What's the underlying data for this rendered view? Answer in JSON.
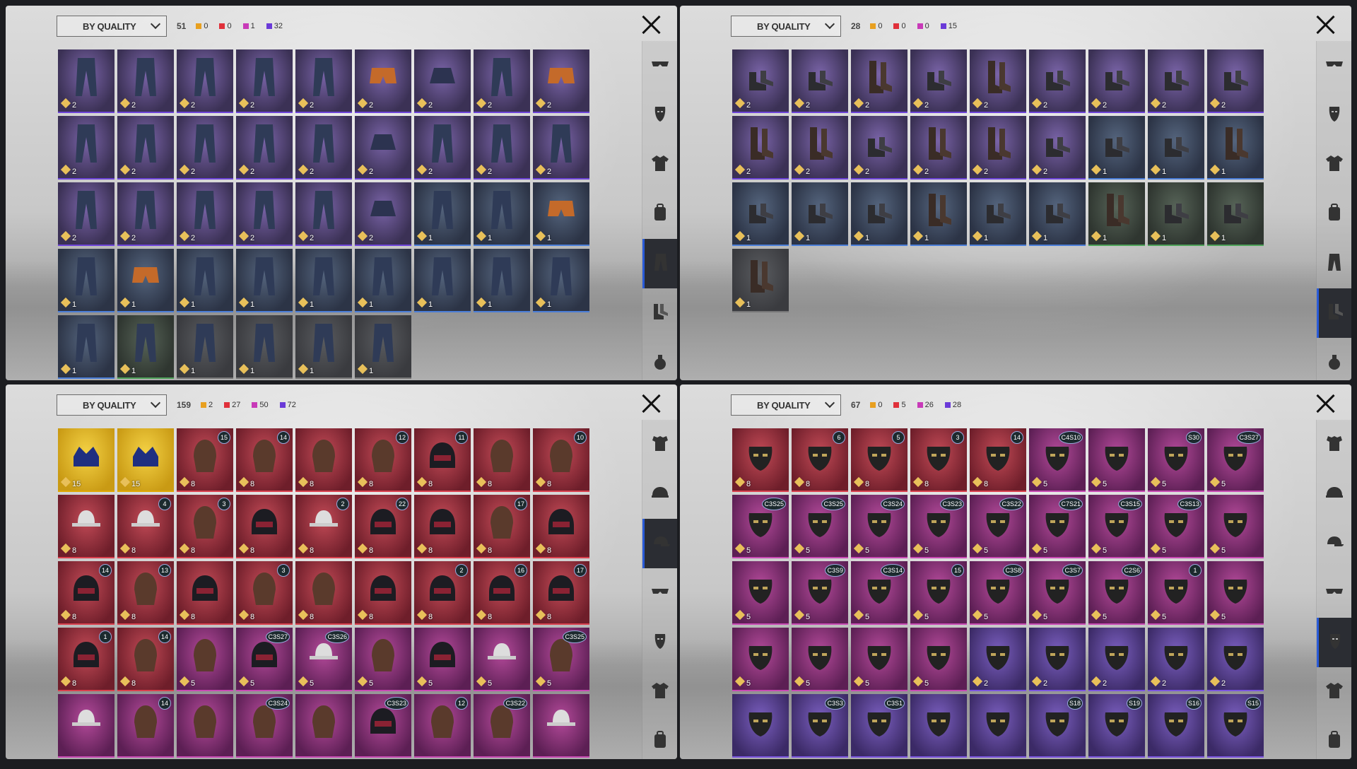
{
  "colors": {
    "legendary": "#e8a020",
    "mythic": "#e0303a",
    "epic": "#c83ab8",
    "rare": "#6a3ad8"
  },
  "panels": [
    {
      "sort_label": "BY QUALITY",
      "total": "51",
      "q": [
        "0",
        "0",
        "1",
        "32"
      ],
      "nav": [
        "goggles-icon",
        "mask-icon",
        "jacket-icon",
        "backpack-icon",
        "pants-icon",
        "shoes-icon",
        "grenade-icon"
      ],
      "active": 4,
      "tiles": [
        [
          "purple",
          "2",
          "pants"
        ],
        [
          "purple",
          "2",
          "pants"
        ],
        [
          "purple",
          "2",
          "pants"
        ],
        [
          "purple",
          "2",
          "pants"
        ],
        [
          "purple",
          "2",
          "pants"
        ],
        [
          "purple",
          "2",
          "shorts"
        ],
        [
          "purple",
          "2",
          "skirt"
        ],
        [
          "purple",
          "2",
          "pants"
        ],
        [
          "purple",
          "2",
          "shorts"
        ],
        [
          "purple",
          "2",
          "pants"
        ],
        [
          "purple",
          "2",
          "pants"
        ],
        [
          "purple",
          "2",
          "pants"
        ],
        [
          "purple",
          "2",
          "pants"
        ],
        [
          "purple",
          "2",
          "pants"
        ],
        [
          "purple",
          "2",
          "skirt"
        ],
        [
          "purple",
          "2",
          "pants"
        ],
        [
          "purple",
          "2",
          "pants"
        ],
        [
          "purple",
          "2",
          "pants"
        ],
        [
          "purple",
          "2",
          "pants"
        ],
        [
          "purple",
          "2",
          "pants"
        ],
        [
          "purple",
          "2",
          "pants"
        ],
        [
          "purple",
          "2",
          "pants"
        ],
        [
          "purple",
          "2",
          "pants"
        ],
        [
          "purple",
          "2",
          "skirt"
        ],
        [
          "blue",
          "1",
          "pants"
        ],
        [
          "blue",
          "1",
          "pants"
        ],
        [
          "blue",
          "1",
          "shorts"
        ],
        [
          "blue",
          "1",
          "pants"
        ],
        [
          "blue",
          "1",
          "shorts"
        ],
        [
          "blue",
          "1",
          "pants"
        ],
        [
          "blue",
          "1",
          "pants"
        ],
        [
          "blue",
          "1",
          "pants"
        ],
        [
          "blue",
          "1",
          "pants"
        ],
        [
          "blue",
          "1",
          "pants"
        ],
        [
          "blue",
          "1",
          "pants"
        ],
        [
          "blue",
          "1",
          "pants"
        ],
        [
          "blue",
          "1",
          "pants"
        ],
        [
          "green",
          "1",
          "pants"
        ],
        [
          "gray",
          "1",
          "pants"
        ],
        [
          "gray",
          "1",
          "pants"
        ],
        [
          "gray",
          "1",
          "pants"
        ],
        [
          "gray",
          "1",
          "pants"
        ]
      ]
    },
    {
      "sort_label": "BY QUALITY",
      "total": "28",
      "q": [
        "0",
        "0",
        "0",
        "15"
      ],
      "nav": [
        "goggles-icon",
        "mask-icon",
        "jacket-icon",
        "backpack-icon",
        "pants-icon",
        "shoes-icon",
        "grenade-icon"
      ],
      "active": 5,
      "tiles": [
        [
          "purple",
          "2",
          "shoe"
        ],
        [
          "purple",
          "2",
          "shoe"
        ],
        [
          "purple",
          "2",
          "boot"
        ],
        [
          "purple",
          "2",
          "shoe"
        ],
        [
          "purple",
          "2",
          "boot"
        ],
        [
          "purple",
          "2",
          "shoe"
        ],
        [
          "purple",
          "2",
          "shoe"
        ],
        [
          "purple",
          "2",
          "shoe"
        ],
        [
          "purple",
          "2",
          "shoe"
        ],
        [
          "purple",
          "2",
          "boot"
        ],
        [
          "purple",
          "2",
          "boot"
        ],
        [
          "purple",
          "2",
          "shoe"
        ],
        [
          "purple",
          "2",
          "boot"
        ],
        [
          "purple",
          "2",
          "boot"
        ],
        [
          "purple",
          "2",
          "shoe"
        ],
        [
          "blue",
          "1",
          "shoe"
        ],
        [
          "blue",
          "1",
          "shoe"
        ],
        [
          "blue",
          "1",
          "boot"
        ],
        [
          "blue",
          "1",
          "shoe"
        ],
        [
          "blue",
          "1",
          "shoe"
        ],
        [
          "blue",
          "1",
          "shoe"
        ],
        [
          "blue",
          "1",
          "boot"
        ],
        [
          "blue",
          "1",
          "shoe"
        ],
        [
          "blue",
          "1",
          "shoe"
        ],
        [
          "green",
          "1",
          "boot"
        ],
        [
          "green",
          "1",
          "shoe"
        ],
        [
          "green",
          "1",
          "shoe"
        ],
        [
          "gray",
          "1",
          "boot"
        ]
      ]
    },
    {
      "sort_label": "BY QUALITY",
      "total": "159",
      "q": [
        "2",
        "27",
        "50",
        "72"
      ],
      "nav": [
        "outfit-icon",
        "helmet-icon",
        "cap-icon",
        "goggles-icon",
        "mask-icon",
        "jacket-icon",
        "backpack-icon"
      ],
      "active": 2,
      "tiles": [
        [
          "gold",
          "15",
          "crown",
          ""
        ],
        [
          "gold",
          "15",
          "crown",
          ""
        ],
        [
          "red",
          "8",
          "hair",
          "15"
        ],
        [
          "red",
          "8",
          "hair",
          "14"
        ],
        [
          "red",
          "8",
          "hair",
          ""
        ],
        [
          "red",
          "8",
          "hair",
          "12"
        ],
        [
          "red",
          "8",
          "helmet",
          "11"
        ],
        [
          "red",
          "8",
          "hair",
          ""
        ],
        [
          "red",
          "8",
          "hair",
          "10"
        ],
        [
          "red",
          "8",
          "hat",
          ""
        ],
        [
          "red",
          "8",
          "hat",
          "4"
        ],
        [
          "red",
          "8",
          "hair",
          "3"
        ],
        [
          "red",
          "8",
          "helmet",
          ""
        ],
        [
          "red",
          "8",
          "hat",
          "2"
        ],
        [
          "red",
          "8",
          "helmet",
          "22"
        ],
        [
          "red",
          "8",
          "helmet",
          ""
        ],
        [
          "red",
          "8",
          "hair",
          "17"
        ],
        [
          "red",
          "8",
          "helmet",
          ""
        ],
        [
          "red",
          "8",
          "helmet",
          "14"
        ],
        [
          "red",
          "8",
          "hair",
          "13"
        ],
        [
          "red",
          "8",
          "helmet",
          ""
        ],
        [
          "red",
          "8",
          "hair",
          "3"
        ],
        [
          "red",
          "8",
          "hair",
          ""
        ],
        [
          "red",
          "8",
          "helmet",
          ""
        ],
        [
          "red",
          "8",
          "helmet",
          "2"
        ],
        [
          "red",
          "8",
          "helmet",
          "16"
        ],
        [
          "red",
          "8",
          "helmet",
          "17"
        ],
        [
          "red",
          "8",
          "helmet",
          "1"
        ],
        [
          "red",
          "8",
          "hair",
          "14"
        ],
        [
          "mag",
          "5",
          "hair",
          ""
        ],
        [
          "mag",
          "5",
          "helmet",
          "C3S27"
        ],
        [
          "mag",
          "5",
          "hat",
          "C3S26"
        ],
        [
          "mag",
          "5",
          "hair",
          ""
        ],
        [
          "mag",
          "5",
          "helmet",
          ""
        ],
        [
          "mag",
          "5",
          "hat",
          ""
        ],
        [
          "mag",
          "5",
          "hair",
          "C3S25"
        ],
        [
          "mag",
          "",
          "hat",
          ""
        ],
        [
          "mag",
          "",
          "hair",
          "14"
        ],
        [
          "mag",
          "",
          "hair",
          ""
        ],
        [
          "mag",
          "",
          "hair",
          "C3S24"
        ],
        [
          "mag",
          "",
          "hair",
          ""
        ],
        [
          "mag",
          "",
          "helmet",
          "C3S23"
        ],
        [
          "mag",
          "",
          "hair",
          "12"
        ],
        [
          "mag",
          "",
          "hair",
          "C3S22"
        ],
        [
          "mag",
          "",
          "hat",
          ""
        ]
      ]
    },
    {
      "sort_label": "BY QUALITY",
      "total": "67",
      "q": [
        "0",
        "5",
        "26",
        "28"
      ],
      "nav": [
        "outfit-icon",
        "helmet-icon",
        "cap-icon",
        "goggles-icon",
        "mask-icon",
        "jacket-icon",
        "backpack-icon"
      ],
      "active": 4,
      "tiles": [
        [
          "red",
          "8",
          "mask",
          ""
        ],
        [
          "red",
          "8",
          "mask",
          "6"
        ],
        [
          "red",
          "8",
          "mask",
          "5"
        ],
        [
          "red",
          "8",
          "mask",
          "3"
        ],
        [
          "red",
          "8",
          "mask",
          "14"
        ],
        [
          "mag",
          "5",
          "mask",
          "C4S10"
        ],
        [
          "mag",
          "5",
          "mask",
          ""
        ],
        [
          "mag",
          "5",
          "mask",
          "S30"
        ],
        [
          "mag",
          "5",
          "mask",
          "C3S27"
        ],
        [
          "mag",
          "5",
          "mask",
          "C3S25"
        ],
        [
          "mag",
          "5",
          "mask",
          "C3S25"
        ],
        [
          "mag",
          "5",
          "mask",
          "C3S24"
        ],
        [
          "mag",
          "5",
          "mask",
          "C3S23"
        ],
        [
          "mag",
          "5",
          "mask",
          "C3S22"
        ],
        [
          "mag",
          "5",
          "mask",
          "C7S21"
        ],
        [
          "mag",
          "5",
          "mask",
          "C3S15"
        ],
        [
          "mag",
          "5",
          "mask",
          "C3S13"
        ],
        [
          "mag",
          "5",
          "mask",
          ""
        ],
        [
          "mag",
          "5",
          "mask",
          ""
        ],
        [
          "mag",
          "5",
          "mask",
          "C3S9"
        ],
        [
          "mag",
          "5",
          "mask",
          "C3S14"
        ],
        [
          "mag",
          "5",
          "mask",
          "15"
        ],
        [
          "mag",
          "5",
          "mask",
          "C3S8"
        ],
        [
          "mag",
          "5",
          "mask",
          "C3S7"
        ],
        [
          "mag",
          "5",
          "mask",
          "C2S6"
        ],
        [
          "mag",
          "5",
          "mask",
          "1"
        ],
        [
          "mag",
          "5",
          "mask",
          ""
        ],
        [
          "mag",
          "5",
          "mask",
          ""
        ],
        [
          "mag",
          "5",
          "mask",
          ""
        ],
        [
          "mag",
          "5",
          "mask",
          ""
        ],
        [
          "mag",
          "5",
          "mask",
          ""
        ],
        [
          "violet",
          "2",
          "mask",
          ""
        ],
        [
          "violet",
          "2",
          "mask",
          ""
        ],
        [
          "violet",
          "2",
          "mask",
          ""
        ],
        [
          "violet",
          "2",
          "mask",
          ""
        ],
        [
          "violet",
          "2",
          "mask",
          ""
        ],
        [
          "violet",
          "",
          "mask",
          ""
        ],
        [
          "violet",
          "",
          "mask",
          "C3S3"
        ],
        [
          "violet",
          "",
          "mask",
          "C3S1"
        ],
        [
          "violet",
          "",
          "mask",
          ""
        ],
        [
          "violet",
          "",
          "mask",
          ""
        ],
        [
          "violet",
          "",
          "mask",
          "S18"
        ],
        [
          "violet",
          "",
          "mask",
          "S19"
        ],
        [
          "violet",
          "",
          "mask",
          "S16"
        ],
        [
          "violet",
          "",
          "mask",
          "S15"
        ]
      ]
    }
  ]
}
